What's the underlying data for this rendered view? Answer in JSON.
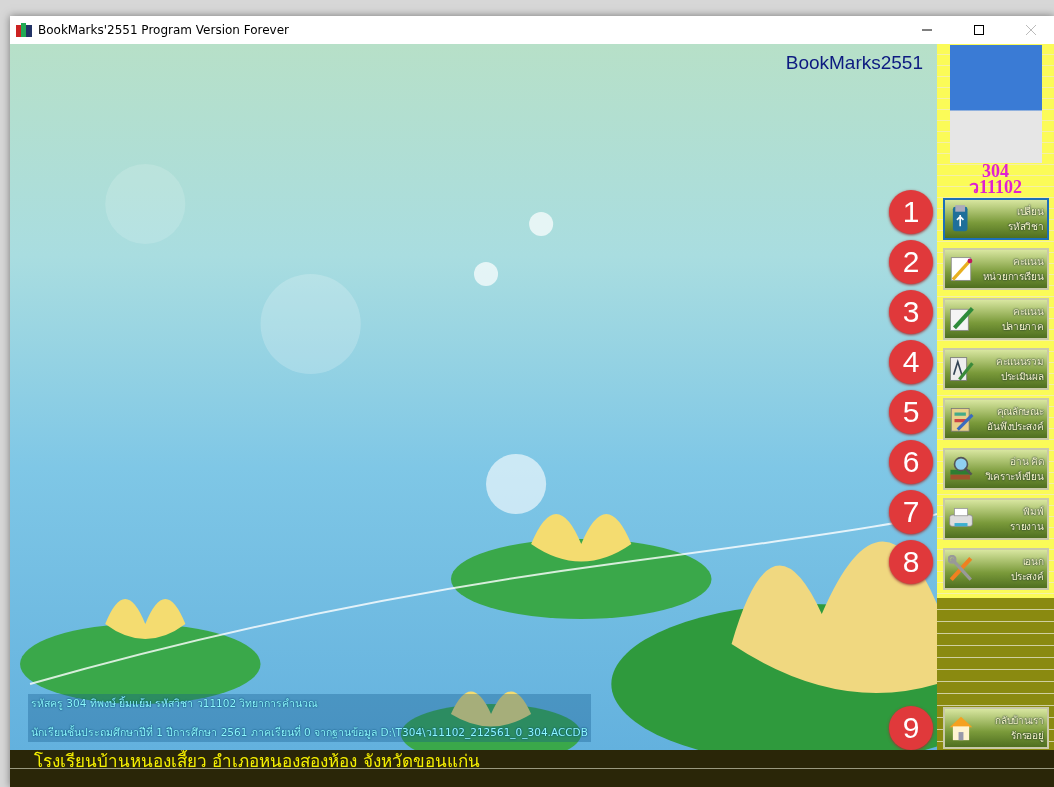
{
  "window": {
    "title": "BookMarks'2551 Program Version Forever"
  },
  "brand": "BookMarks2551",
  "profile": {
    "teacher_code": "304",
    "subject_code": "ว11102"
  },
  "menu": [
    {
      "number": "1",
      "line1": "เปลี่ยน",
      "line2": "รหัสวิชา",
      "selected": true
    },
    {
      "number": "2",
      "line1": "คะแนน",
      "line2": "หน่วยการเรียน",
      "selected": false
    },
    {
      "number": "3",
      "line1": "คะแนน",
      "line2": "ปลายภาค",
      "selected": false
    },
    {
      "number": "4",
      "line1": "คะแนนรวม",
      "line2": "ประเมินผล",
      "selected": false
    },
    {
      "number": "5",
      "line1": "คุณลักษณะ",
      "line2": "อันพึงประสงค์",
      "selected": false
    },
    {
      "number": "6",
      "line1": "อ่าน คิด",
      "line2": "วิเคราะห์เขียน",
      "selected": false
    },
    {
      "number": "7",
      "line1": "พิมพ์",
      "line2": "รายงาน",
      "selected": false
    },
    {
      "number": "8",
      "line1": "เอนก",
      "line2": "ประสงค์",
      "selected": false
    }
  ],
  "home_button": {
    "number": "9",
    "line1": "กลับบ้านเรา",
    "line2": "รักรออยู่"
  },
  "info_lines": [
    "รหัสครู 304 ทิพงษ์ ยิ้มแย้ม รหัสวิชา ว11102 วิทยาการคำนวณ",
    "นักเรียนชั้นประถมศึกษาปีที่ 1  ปีการศึกษา 2561  ภาคเรียนที่  0  จากฐานข้อมูล D:\\T304\\ว11102_212561_0_304.ACCDB"
  ],
  "school_line": "โรงเรียนบ้านหนองเสี้ยว  อำเภอหนองสองห้อง  จังหวัดขอนแก่น"
}
